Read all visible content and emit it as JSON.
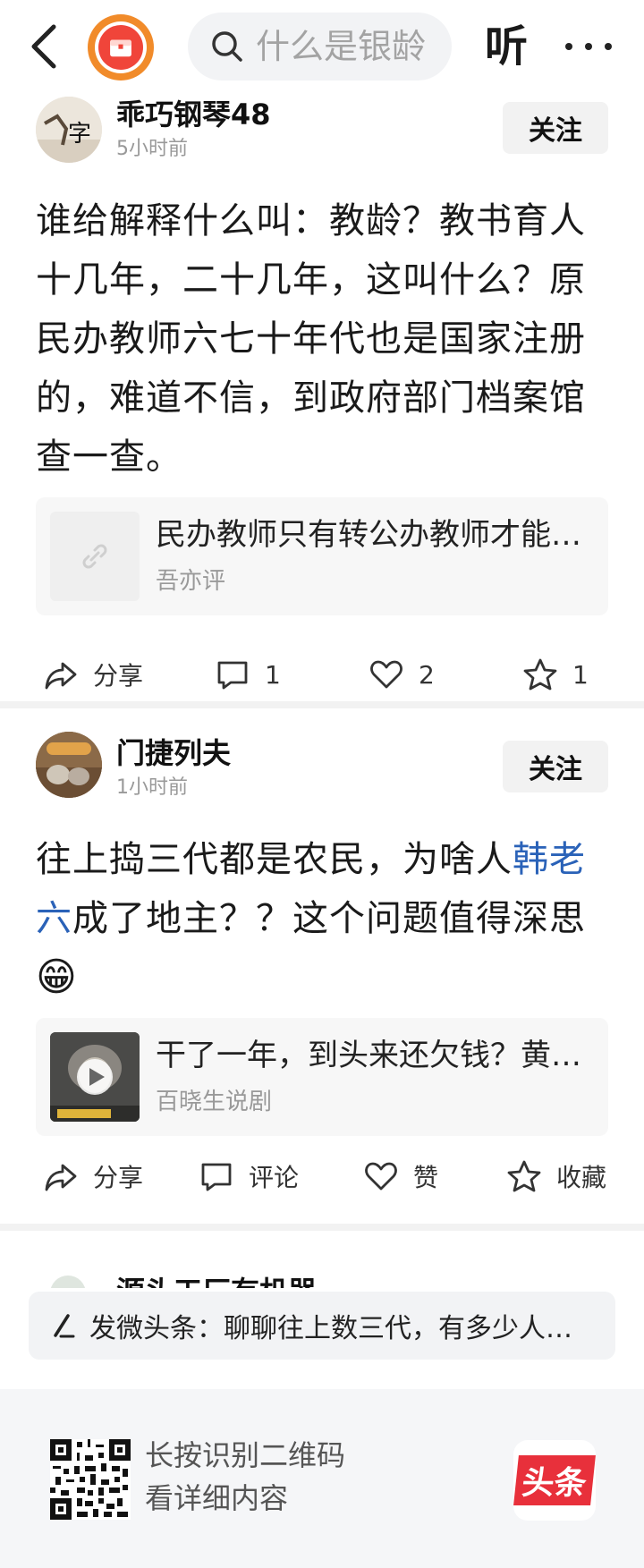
{
  "header": {
    "search_placeholder": "什么是银龄",
    "listen_label": "听"
  },
  "posts": [
    {
      "author": "乖巧钢琴48",
      "time": "5小时前",
      "follow_label": "关注",
      "text": "谁给解释什么叫：教龄？教书育人十几年，二十几年，这叫什么？原民办教师六七十年代也是国家注册的，难道不信，到政府部门档案馆查一查。",
      "card": {
        "title": "民办教师只有转公办教师才能享受教龄补贴...",
        "source": "吾亦评"
      },
      "actions": {
        "share": "分享",
        "comment": "1",
        "like": "2",
        "favorite": "1"
      }
    },
    {
      "author": "门捷列夫",
      "time": "1小时前",
      "follow_label": "关注",
      "text_before": "往上捣三代都是农民，为啥人",
      "text_link": "韩老六",
      "text_after": "成了地主？？这个问题值得深思",
      "emoji": "😁",
      "card": {
        "title": "干了一年，到头来还欠钱？黄世仁",
        "source": "百晓生说剧"
      },
      "actions": {
        "share": "分享",
        "comment": "评论",
        "like": "赞",
        "favorite": "收藏"
      }
    }
  ],
  "next_post_author_peek": "源头工厂有机器",
  "compose": {
    "text": "发微头条：聊聊往上数三代，有多少人是地主"
  },
  "footer": {
    "line1": "长按识别二维码",
    "line2": "看详细内容",
    "brand": "头条"
  },
  "colors": {
    "link": "#2a62b8",
    "brand_red": "#e8303b",
    "logo_orange": "#f18b2a"
  }
}
